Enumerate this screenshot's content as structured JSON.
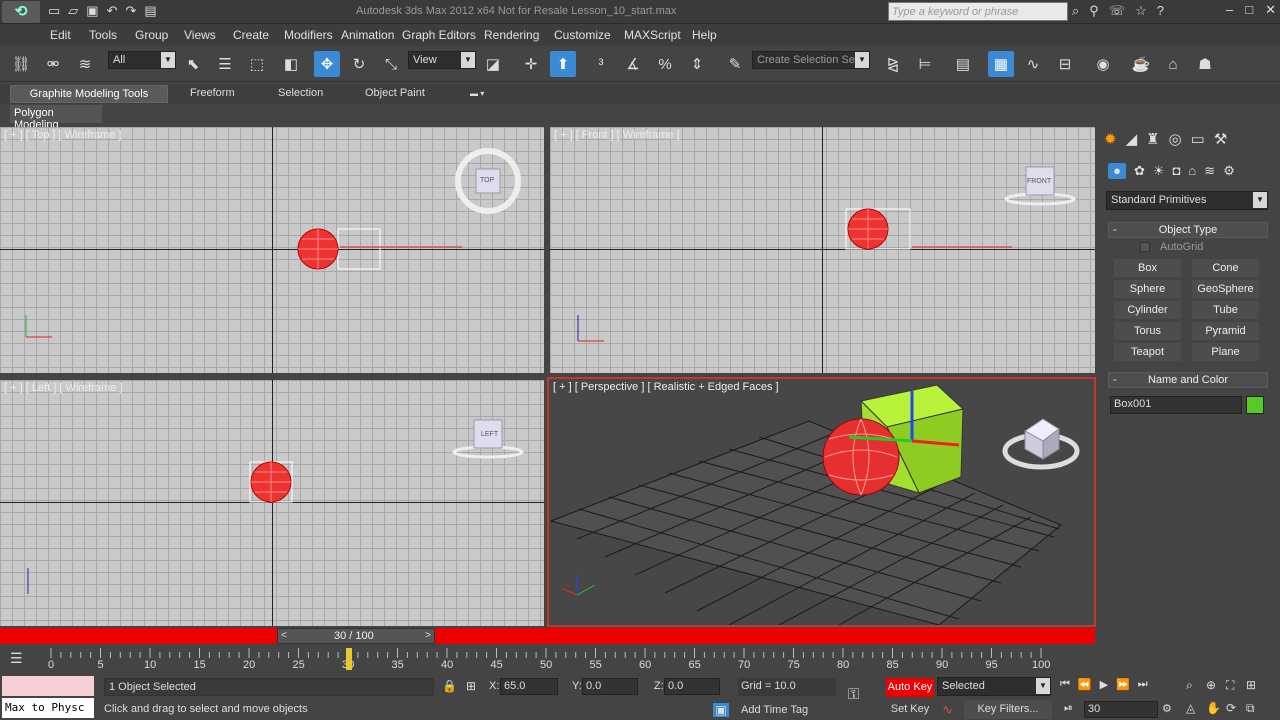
{
  "window": {
    "title": "Autodesk 3ds Max 2012 x64  Not for Resale   Lesson_10_start.max",
    "search_placeholder": "Type a keyword or phrase"
  },
  "menu": [
    "Edit",
    "Tools",
    "Group",
    "Views",
    "Create",
    "Modifiers",
    "Animation",
    "Graph Editors",
    "Rendering",
    "Customize",
    "MAXScript",
    "Help"
  ],
  "toolbar": {
    "filter_value": "All",
    "refcoord_value": "View",
    "selection_set_placeholder": "Create Selection Se"
  },
  "ribbon": {
    "tabs": [
      "Graphite Modeling Tools",
      "Freeform",
      "Selection",
      "Object Paint"
    ],
    "sub_tab": "Polygon Modeling"
  },
  "viewports": {
    "top": {
      "label": "[ + ] [ Top ] [ Wireframe ]",
      "cube_label": "TOP"
    },
    "front": {
      "label": "[ + ] [ Front ] [ Wireframe ]",
      "cube_label": "FRONT"
    },
    "left": {
      "label": "[ + ] [ Left ] [ Wireframe ]",
      "cube_label": "LEFT"
    },
    "perspective": {
      "label": "[ + ] [ Perspective ] [ Realistic + Edged Faces ]"
    }
  },
  "time": {
    "frame_display": "30 / 100",
    "current_frame": 30,
    "ticks": [
      "0",
      "5",
      "10",
      "15",
      "20",
      "25",
      "30",
      "35",
      "40",
      "45",
      "50",
      "55",
      "60",
      "65",
      "70",
      "75",
      "80",
      "85",
      "90",
      "95",
      "100"
    ]
  },
  "status": {
    "objects_selected": "1 Object Selected",
    "prompt": "Click and drag to select and move objects",
    "x_label": "X:",
    "x_value": "65.0",
    "y_label": "Y:",
    "y_value": "0.0",
    "z_label": "Z:",
    "z_value": "0.0",
    "grid": "Grid = 10.0",
    "add_time_tag": "Add Time Tag",
    "auto_key": "Auto Key",
    "set_key": "Set Key",
    "key_mode": "Selected",
    "key_filters": "Key Filters...",
    "frame_field": "30",
    "script_listener": "Max to Physc"
  },
  "command_panel": {
    "category": "Standard Primitives",
    "object_type_title": "Object Type",
    "autogrid": "AutoGrid",
    "buttons": [
      "Box",
      "Cone",
      "Sphere",
      "GeoSphere",
      "Cylinder",
      "Tube",
      "Torus",
      "Pyramid",
      "Teapot",
      "Plane"
    ],
    "name_color_title": "Name and Color",
    "object_name": "Box001",
    "object_color": "#55cc22"
  },
  "colors": {
    "accent": "#3a8ad6",
    "active_viewport": "#c8352a",
    "timeslider": "#e00000",
    "auto_key": "#e00000"
  }
}
